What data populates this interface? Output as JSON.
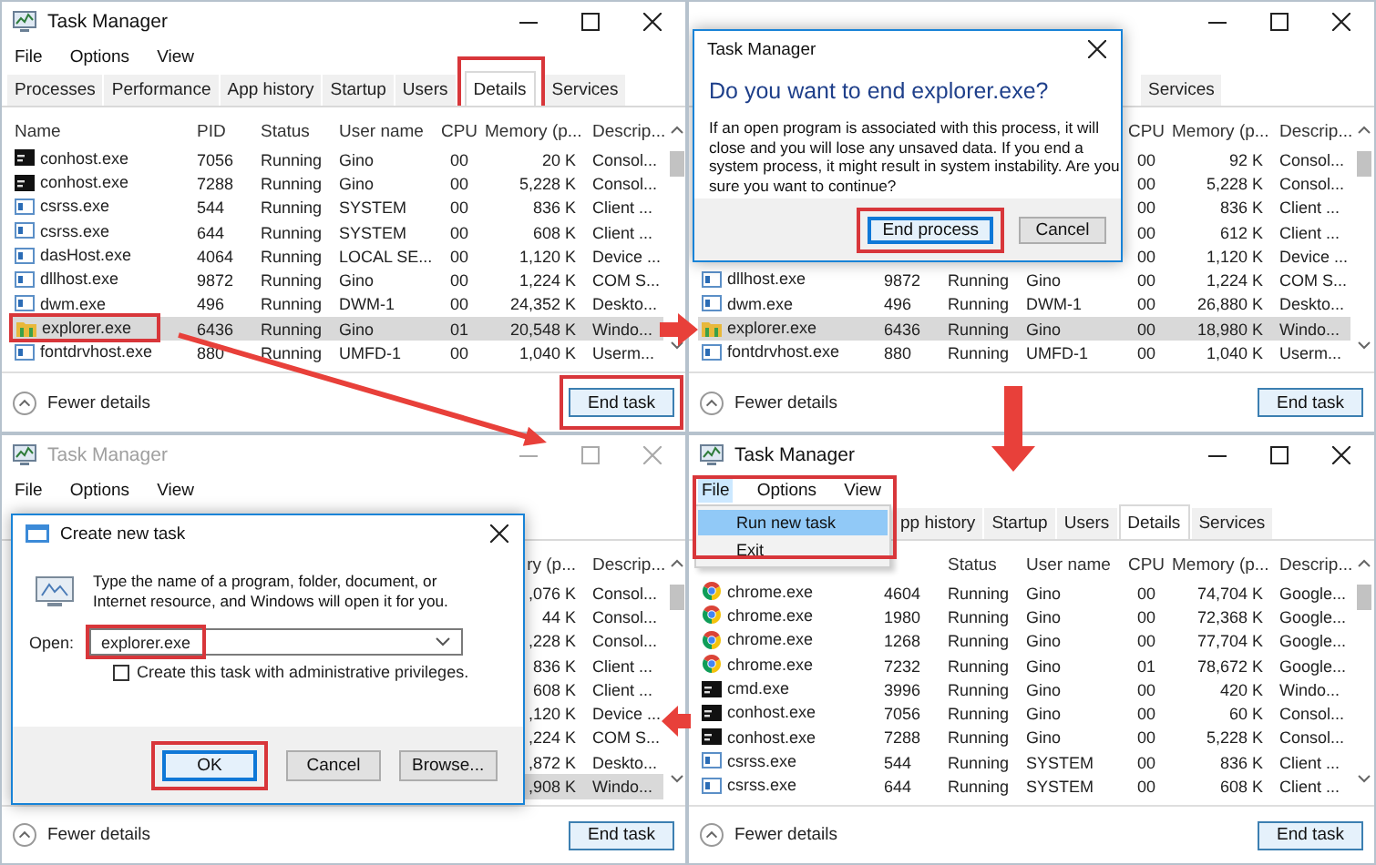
{
  "panels": [
    {
      "kind": "details",
      "window": {
        "title": "Task Manager",
        "active": true
      },
      "menu": [
        {
          "label": "File",
          "selected": false
        },
        {
          "label": "Options",
          "selected": false
        },
        {
          "label": "View",
          "selected": false
        }
      ],
      "tabs": [
        {
          "label": "Processes",
          "selected": false,
          "highlighted": false
        },
        {
          "label": "Performance",
          "selected": false,
          "highlighted": false
        },
        {
          "label": "App history",
          "selected": false,
          "highlighted": false
        },
        {
          "label": "Startup",
          "selected": false,
          "highlighted": false
        },
        {
          "label": "Users",
          "selected": false,
          "highlighted": false
        },
        {
          "label": "Details",
          "selected": true,
          "highlighted": true
        },
        {
          "label": "Services",
          "selected": false,
          "highlighted": false
        }
      ],
      "table": {
        "columns": {
          "name": "Name",
          "pid": "PID",
          "status": "Status",
          "user": "User name",
          "cpu": "CPU",
          "memory": "Memory (p...",
          "description": "Descrip..."
        },
        "rows": [
          {
            "kind": "console",
            "name": "conhost.exe",
            "pid": "7056",
            "status": "Running",
            "user": "Gino",
            "cpu": "00",
            "memory": "20 K",
            "description": "Consol...",
            "selected": false,
            "highlighted": false
          },
          {
            "kind": "console",
            "name": "conhost.exe",
            "pid": "7288",
            "status": "Running",
            "user": "Gino",
            "cpu": "00",
            "memory": "5,228 K",
            "description": "Consol...",
            "selected": false,
            "highlighted": false
          },
          {
            "kind": "system",
            "name": "csrss.exe",
            "pid": "544",
            "status": "Running",
            "user": "SYSTEM",
            "cpu": "00",
            "memory": "836 K",
            "description": "Client ...",
            "selected": false,
            "highlighted": false
          },
          {
            "kind": "system",
            "name": "csrss.exe",
            "pid": "644",
            "status": "Running",
            "user": "SYSTEM",
            "cpu": "00",
            "memory": "608 K",
            "description": "Client ...",
            "selected": false,
            "highlighted": false
          },
          {
            "kind": "system",
            "name": "dasHost.exe",
            "pid": "4064",
            "status": "Running",
            "user": "LOCAL SE...",
            "cpu": "00",
            "memory": "1,120 K",
            "description": "Device ...",
            "selected": false,
            "highlighted": false
          },
          {
            "kind": "system",
            "name": "dllhost.exe",
            "pid": "9872",
            "status": "Running",
            "user": "Gino",
            "cpu": "00",
            "memory": "1,224 K",
            "description": "COM S...",
            "selected": false,
            "highlighted": false
          },
          {
            "kind": "system",
            "name": "dwm.exe",
            "pid": "496",
            "status": "Running",
            "user": "DWM-1",
            "cpu": "00",
            "memory": "24,352 K",
            "description": "Deskto...",
            "selected": false,
            "highlighted": false
          },
          {
            "kind": "folder",
            "name": "explorer.exe",
            "pid": "6436",
            "status": "Running",
            "user": "Gino",
            "cpu": "01",
            "memory": "20,548 K",
            "description": "Windo...",
            "selected": true,
            "highlighted": true
          },
          {
            "kind": "system",
            "name": "fontdrvhost.exe",
            "pid": "880",
            "status": "Running",
            "user": "UMFD-1",
            "cpu": "00",
            "memory": "1,040 K",
            "description": "Userm...",
            "selected": false,
            "highlighted": false
          }
        ]
      },
      "footer": {
        "toggle": "Fewer details",
        "button": {
          "label": "End task",
          "highlighted": true
        }
      }
    },
    {
      "kind": "confirm",
      "window": {
        "active": true
      },
      "tabs": [
        {
          "label": "Services",
          "selected": false,
          "highlighted": false
        }
      ],
      "table": {
        "columns": {
          "cpu": "CPU",
          "memory": "Memory (p...",
          "description": "Descrip..."
        },
        "rows": [
          {
            "cpu": "00",
            "memory": "92 K",
            "description": "Consol...",
            "selected": false
          },
          {
            "cpu": "00",
            "memory": "5,228 K",
            "description": "Consol...",
            "selected": false
          },
          {
            "cpu": "00",
            "memory": "836 K",
            "description": "Client ...",
            "selected": false
          },
          {
            "cpu": "00",
            "memory": "612 K",
            "description": "Client ...",
            "selected": false
          },
          {
            "cpu": "00",
            "memory": "1,120 K",
            "description": "Device ...",
            "selected": false
          },
          {
            "kind": "system",
            "name": "dllhost.exe",
            "pid": "9872",
            "status": "Running",
            "user": "Gino",
            "cpu": "00",
            "memory": "1,224 K",
            "description": "COM S...",
            "selected": false,
            "highlighted": false
          },
          {
            "kind": "system",
            "name": "dwm.exe",
            "pid": "496",
            "status": "Running",
            "user": "DWM-1",
            "cpu": "00",
            "memory": "26,880 K",
            "description": "Deskto...",
            "selected": false,
            "highlighted": false
          },
          {
            "kind": "folder",
            "name": "explorer.exe",
            "pid": "6436",
            "status": "Running",
            "user": "Gino",
            "cpu": "00",
            "memory": "18,980 K",
            "description": "Windo...",
            "selected": true,
            "highlighted": false
          },
          {
            "kind": "system",
            "name": "fontdrvhost.exe",
            "pid": "880",
            "status": "Running",
            "user": "UMFD-1",
            "cpu": "00",
            "memory": "1,040 K",
            "description": "Userm...",
            "selected": false,
            "highlighted": false
          }
        ]
      },
      "footer": {
        "toggle": "Fewer details",
        "button": {
          "label": "End task",
          "highlighted": false
        }
      },
      "dialog": {
        "kind": "confirm",
        "title": "Task Manager",
        "heading": "Do you want to end explorer.exe?",
        "message": "If an open program is associated with this process, it will close and you will lose any unsaved data. If you end a system process, it might result in system instability. Are you sure you want to continue?",
        "buttons": [
          {
            "label": "End process",
            "focused": true,
            "highlighted": true
          },
          {
            "label": "Cancel",
            "focused": false,
            "highlighted": false
          }
        ]
      }
    },
    {
      "kind": "run",
      "window": {
        "title": "Task Manager",
        "active": false
      },
      "menu": [
        {
          "label": "File",
          "selected": false
        },
        {
          "label": "Options",
          "selected": false
        },
        {
          "label": "View",
          "selected": false
        }
      ],
      "table": {
        "columns": {
          "memory": "ry (p...",
          "description": "Descrip..."
        },
        "rows": [
          {
            "memory": ",076 K",
            "description": "Consol...",
            "selected": false
          },
          {
            "memory": "44 K",
            "description": "Consol...",
            "selected": false
          },
          {
            "memory": ",228 K",
            "description": "Consol...",
            "selected": false
          },
          {
            "memory": "836 K",
            "description": "Client ...",
            "selected": false
          },
          {
            "memory": "608 K",
            "description": "Client ...",
            "selected": false
          },
          {
            "memory": ",120 K",
            "description": "Device ...",
            "selected": false
          },
          {
            "memory": ",224 K",
            "description": "COM S...",
            "selected": false
          },
          {
            "memory": ",872 K",
            "description": "Deskto...",
            "selected": false
          },
          {
            "memory": ",908 K",
            "description": "Windo...",
            "selected": true
          }
        ]
      },
      "footer": {
        "toggle": "Fewer details",
        "button": {
          "label": "End task",
          "highlighted": false
        }
      },
      "dialog": {
        "kind": "run",
        "title": "Create new task",
        "message": "Type the name of a program, folder, document, or Internet resource, and Windows will open it for you.",
        "field": {
          "label": "Open:",
          "value": "explorer.exe",
          "highlighted": true
        },
        "checkbox": {
          "label": "Create this task with administrative privileges.",
          "checked": false
        },
        "buttons": [
          {
            "label": "OK",
            "focused": true,
            "highlighted": true
          },
          {
            "label": "Cancel",
            "focused": false,
            "highlighted": false
          },
          {
            "label": "Browse...",
            "focused": false,
            "highlighted": false
          }
        ]
      }
    },
    {
      "kind": "menu",
      "window": {
        "title": "Task Manager",
        "active": true
      },
      "menu": [
        {
          "label": "File",
          "selected": true
        },
        {
          "label": "Options",
          "selected": false
        },
        {
          "label": "View",
          "selected": false
        }
      ],
      "dropdown": {
        "highlighted": true,
        "items": [
          {
            "label": "Run new task",
            "selected": true
          },
          {
            "label": "Exit",
            "selected": false
          }
        ]
      },
      "tabs": [
        {
          "label": "pp history",
          "selected": false,
          "highlighted": false
        },
        {
          "label": "Startup",
          "selected": false,
          "highlighted": false
        },
        {
          "label": "Users",
          "selected": false,
          "highlighted": false
        },
        {
          "label": "Details",
          "selected": true,
          "highlighted": false
        },
        {
          "label": "Services",
          "selected": false,
          "highlighted": false
        }
      ],
      "table": {
        "columns": {
          "status": "Status",
          "user": "User name",
          "cpu": "CPU",
          "memory": "Memory (p...",
          "description": "Descrip..."
        },
        "rows": [
          {
            "kind": "chrome",
            "name": "chrome.exe",
            "pid": "4604",
            "status": "Running",
            "user": "Gino",
            "cpu": "00",
            "memory": "74,704 K",
            "description": "Google...",
            "selected": false,
            "highlighted": false
          },
          {
            "kind": "chrome",
            "name": "chrome.exe",
            "pid": "1980",
            "status": "Running",
            "user": "Gino",
            "cpu": "00",
            "memory": "72,368 K",
            "description": "Google...",
            "selected": false,
            "highlighted": false
          },
          {
            "kind": "chrome",
            "name": "chrome.exe",
            "pid": "1268",
            "status": "Running",
            "user": "Gino",
            "cpu": "00",
            "memory": "77,704 K",
            "description": "Google...",
            "selected": false,
            "highlighted": false
          },
          {
            "kind": "chrome",
            "name": "chrome.exe",
            "pid": "7232",
            "status": "Running",
            "user": "Gino",
            "cpu": "01",
            "memory": "78,672 K",
            "description": "Google...",
            "selected": false,
            "highlighted": false
          },
          {
            "kind": "console",
            "name": "cmd.exe",
            "pid": "3996",
            "status": "Running",
            "user": "Gino",
            "cpu": "00",
            "memory": "420 K",
            "description": "Windo...",
            "selected": false,
            "highlighted": false
          },
          {
            "kind": "console",
            "name": "conhost.exe",
            "pid": "7056",
            "status": "Running",
            "user": "Gino",
            "cpu": "00",
            "memory": "60 K",
            "description": "Consol...",
            "selected": false,
            "highlighted": false
          },
          {
            "kind": "console",
            "name": "conhost.exe",
            "pid": "7288",
            "status": "Running",
            "user": "Gino",
            "cpu": "00",
            "memory": "5,228 K",
            "description": "Consol...",
            "selected": false,
            "highlighted": false
          },
          {
            "kind": "system",
            "name": "csrss.exe",
            "pid": "544",
            "status": "Running",
            "user": "SYSTEM",
            "cpu": "00",
            "memory": "836 K",
            "description": "Client ...",
            "selected": false,
            "highlighted": false
          },
          {
            "kind": "system",
            "name": "csrss.exe",
            "pid": "644",
            "status": "Running",
            "user": "SYSTEM",
            "cpu": "00",
            "memory": "608 K",
            "description": "Client ...",
            "selected": false,
            "highlighted": false
          }
        ]
      },
      "footer": {
        "toggle": "Fewer details",
        "button": {
          "label": "End task",
          "highlighted": false
        }
      }
    }
  ]
}
